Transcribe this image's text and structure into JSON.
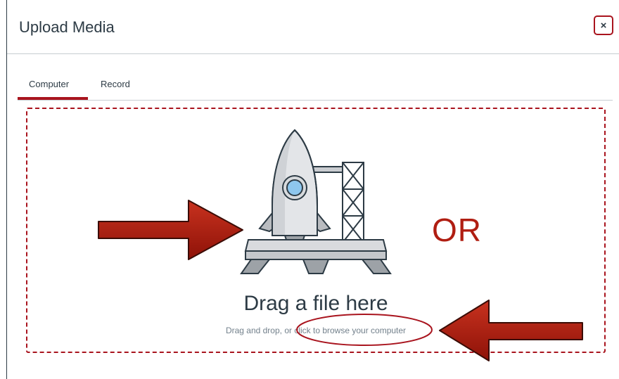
{
  "dialog": {
    "title": "Upload Media",
    "close_label": "×"
  },
  "tabs": [
    {
      "label": "Computer",
      "selected": true
    },
    {
      "label": "Record",
      "selected": false
    }
  ],
  "dropzone": {
    "title": "Drag a file here",
    "subtitle": "Drag and drop, or click to browse your computer",
    "illustration_icon": "rocket-launchpad-icon"
  },
  "annotations": {
    "or_text": "OR",
    "arrow_color": "#b01e12",
    "circle_color": "#a9141e",
    "arrow_icons": [
      "arrow-right-icon",
      "arrow-left-icon"
    ]
  },
  "colors": {
    "accent": "#a9141e",
    "text": "#2d3b45",
    "muted_text": "#73818c",
    "divider": "#c7cdd1"
  }
}
